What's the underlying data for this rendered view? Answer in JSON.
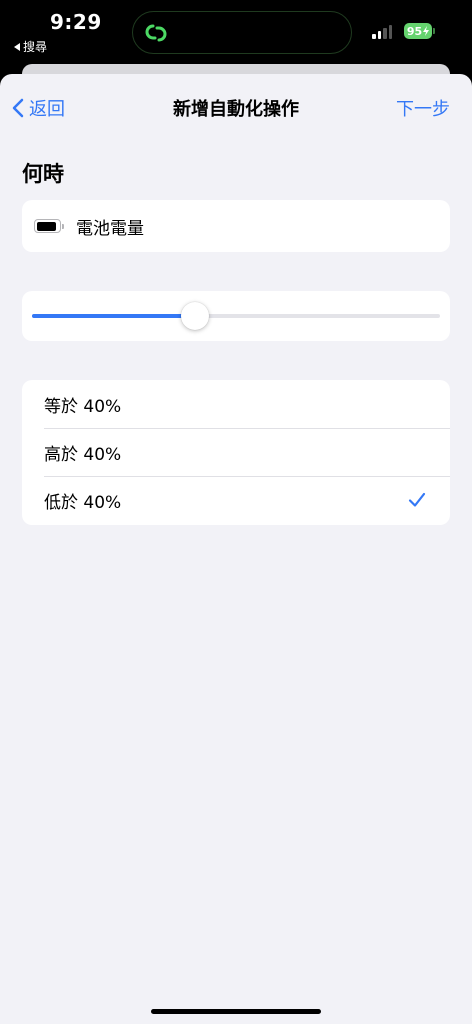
{
  "status_bar": {
    "time": "9:29",
    "back_app": "搜尋",
    "battery_level": "95"
  },
  "nav": {
    "back_label": "返回",
    "title": "新增自動化操作",
    "next_label": "下一步"
  },
  "section": {
    "title": "何時"
  },
  "trigger": {
    "label": "電池電量",
    "icon": "battery-icon"
  },
  "slider": {
    "value_percent": 40
  },
  "options": [
    {
      "label": "等於 40%",
      "selected": false
    },
    {
      "label": "高於 40%",
      "selected": false
    },
    {
      "label": "低於 40%",
      "selected": true
    }
  ],
  "colors": {
    "accent": "#3478f6",
    "background": "#f2f2f7",
    "battery_green": "#65d36e"
  }
}
